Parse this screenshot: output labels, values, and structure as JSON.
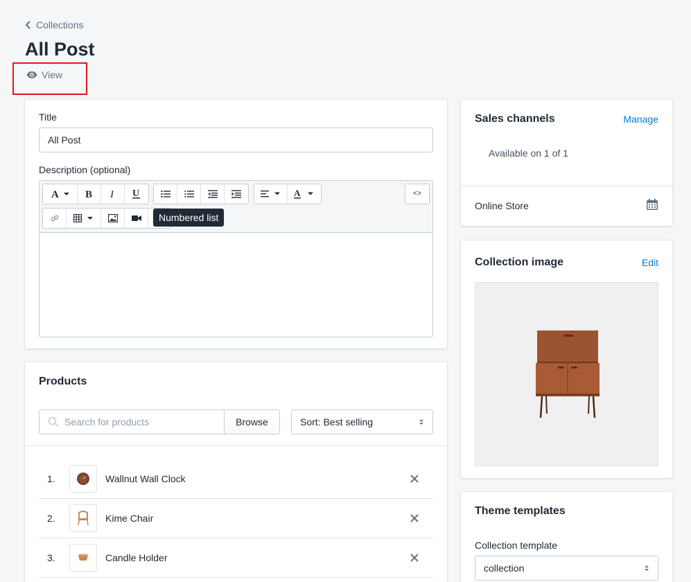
{
  "breadcrumb": {
    "label": "Collections"
  },
  "page": {
    "title": "All Post",
    "view_label": "View"
  },
  "form": {
    "title_label": "Title",
    "title_value": "All Post",
    "description_label": "Description (optional)",
    "tooltip": "Numbered list",
    "toolbar_icons": [
      "font-icon",
      "bold-icon",
      "italic-icon",
      "underline-icon",
      "bulleted-list-icon",
      "numbered-list-icon",
      "outdent-icon",
      "indent-icon",
      "align-icon",
      "text-color-icon",
      "html-icon",
      "link-icon",
      "table-icon",
      "image-icon",
      "video-icon"
    ],
    "html_toggle_label": "<>"
  },
  "products": {
    "title": "Products",
    "search_placeholder": "Search for products",
    "browse_label": "Browse",
    "sort_label": "Sort: Best selling",
    "items": [
      {
        "num": "1.",
        "name": "Wallnut Wall Clock"
      },
      {
        "num": "2.",
        "name": "Kime Chair"
      },
      {
        "num": "3.",
        "name": "Candle Holder"
      }
    ]
  },
  "sales_channels": {
    "title": "Sales channels",
    "manage_label": "Manage",
    "availability": "Available on 1 of 1",
    "channel": "Online Store"
  },
  "collection_image": {
    "title": "Collection image",
    "edit_label": "Edit"
  },
  "theme_templates": {
    "title": "Theme templates",
    "template_label": "Collection template",
    "template_value": "collection"
  },
  "colors": {
    "accent": "#007ace",
    "highlight": "#e0161b",
    "tooltip_bg": "#212b36"
  }
}
